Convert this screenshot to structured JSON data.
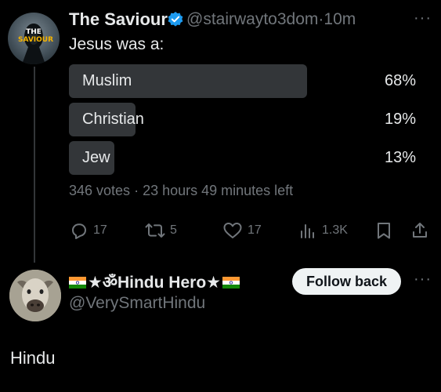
{
  "tweet": {
    "avatar_text": "THE SAVIOUR",
    "display_name": "The Saviour",
    "handle": "@stairwayto3dom",
    "separator": "·",
    "time": "10m",
    "more": "···",
    "text": "Jesus was a:",
    "poll": {
      "options": [
        {
          "label": "Muslim",
          "percent": "68%",
          "fraction": 0.68
        },
        {
          "label": "Christian",
          "percent": "19%",
          "fraction": 0.19
        },
        {
          "label": "Jew",
          "percent": "13%",
          "fraction": 0.13
        }
      ],
      "votes": "346 votes",
      "time_left": "23 hours 49 minutes left"
    },
    "actions": {
      "reply_count": "17",
      "retweet_count": "5",
      "like_count": "17",
      "views_count": "1.3K"
    }
  },
  "reply": {
    "display_name": "★ॐHindu Hero★",
    "handle": "@VerySmartHindu",
    "follow_label": "Follow back",
    "more": "···",
    "text": "Hindu"
  },
  "colors": {
    "background": "#000000",
    "text": "#e7e9ea",
    "muted": "#71767b",
    "poll_bar": "#333639",
    "verified": "#1d9bf0"
  }
}
